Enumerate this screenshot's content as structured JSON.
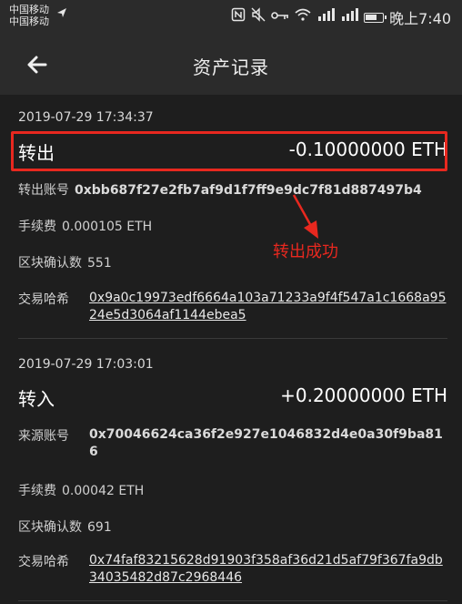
{
  "status_bar": {
    "carrier_1": "中国移动",
    "carrier_2": "中国移动",
    "time": "晚上7:40",
    "net_1": "⁴ᴳ",
    "net_2": "²ᴳ"
  },
  "nav": {
    "title": "资产记录"
  },
  "records": [
    {
      "time": "2019-07-29 17:34:37",
      "type": "转出",
      "amount": "-0.10000000 ETH",
      "address_label": "转出账号",
      "address": "0xbb687f27e2fb7af9d1f7ff9e9dc7f81d887497b4",
      "fee_label": "手续费",
      "fee": "0.000105 ETH",
      "confirm_label": "区块确认数",
      "confirm": "551",
      "hash_label": "交易哈希",
      "hash": "0x9a0c19973edf6664a103a71233a9f4f547a1c1668a9524e5d3064af1144ebea5"
    },
    {
      "time": "2019-07-29 17:03:01",
      "type": "转入",
      "amount": "+0.20000000 ETH",
      "address_label": "来源账号",
      "address": "0x70046624ca36f2e927e1046832d4e0a30f9ba816",
      "fee_label": "手续费",
      "fee": "0.00042 ETH",
      "confirm_label": "区块确认数",
      "confirm": "691",
      "hash_label": "交易哈希",
      "hash": "0x74faf83215628d91903f358af36d21d5af79f367fa9db34035482d87c2968446"
    }
  ],
  "annotation": {
    "text": "转出成功",
    "color": "#e8281f"
  },
  "icons": {
    "back": "back-arrow-icon",
    "nfc": "nfc-icon",
    "mute": "mute-icon",
    "vpn_key": "key-icon",
    "wifi": "wifi-icon",
    "signal": "signal-icon",
    "battery": "battery-icon",
    "location": "location-arrow-icon"
  }
}
